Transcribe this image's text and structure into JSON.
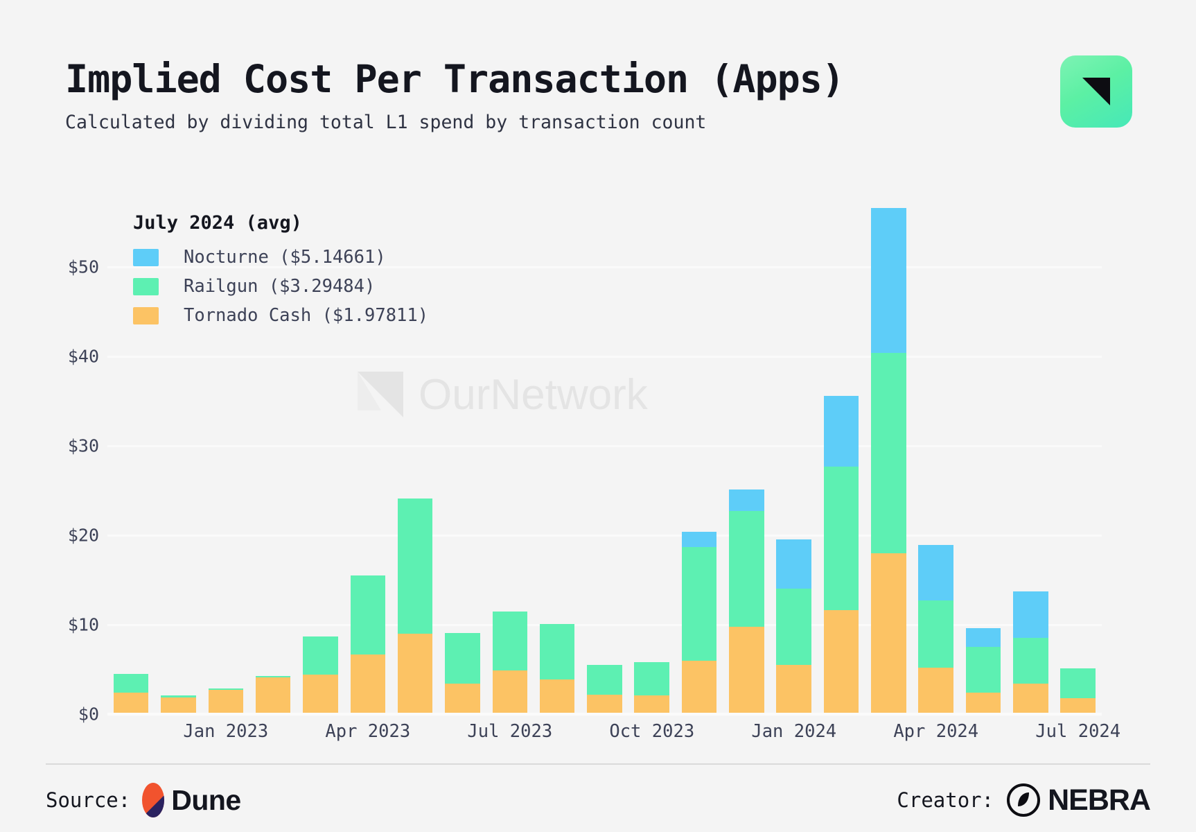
{
  "header": {
    "title": "Implied Cost Per Transaction (Apps)",
    "subtitle": "Calculated by dividing total L1 spend by transaction count",
    "badge_icon": "nebra-corner-triangle-icon"
  },
  "watermark": {
    "text": "OurNetwork",
    "icon": "ournetwork-mark-icon"
  },
  "legend": {
    "title": "July 2024 (avg)",
    "items": [
      {
        "label": "Nocturne ($5.14661)",
        "color": "#5ecdf8",
        "series": "Nocturne",
        "value": "$5.14661"
      },
      {
        "label": "Railgun ($3.29484)",
        "color": "#5df0b2",
        "series": "Railgun",
        "value": "$3.29484"
      },
      {
        "label": "Tornado Cash ($1.97811)",
        "color": "#fcc364",
        "series": "Tornado Cash",
        "value": "$1.97811"
      }
    ]
  },
  "footer": {
    "source_label": "Source:",
    "source_name": "Dune",
    "source_icon": "dune-ellipse-logo-icon",
    "creator_label": "Creator:",
    "creator_name": "NEBRA",
    "creator_icon": "nebra-circle-logo-icon"
  },
  "chart_data": {
    "type": "bar",
    "stacked": true,
    "title": "Implied Cost Per Transaction (Apps)",
    "subtitle": "Calculated by dividing total L1 spend by transaction count",
    "xlabel": "",
    "ylabel": "",
    "ylim": [
      0,
      57
    ],
    "grid": true,
    "legend_position": "top-left",
    "ytick_labels": [
      "$0",
      "$10",
      "$20",
      "$30",
      "$40",
      "$50"
    ],
    "ytick_values": [
      0,
      10,
      20,
      30,
      40,
      50
    ],
    "x": [
      "Nov 2022",
      "Dec 2022",
      "Jan 2023",
      "Feb 2023",
      "Mar 2023",
      "Apr 2023",
      "May 2023",
      "Jun 2023",
      "Jul 2023",
      "Aug 2023",
      "Sep 2023",
      "Oct 2023",
      "Nov 2023",
      "Dec 2023",
      "Jan 2024",
      "Feb 2024",
      "Mar 2024",
      "Apr 2024",
      "May 2024",
      "Jun 2024",
      "Jul 2024"
    ],
    "xtick_labels": [
      "Jan 2023",
      "Apr 2023",
      "Jul 2023",
      "Oct 2023",
      "Jan 2024",
      "Apr 2024",
      "Jul 2024"
    ],
    "xtick_indices": [
      2,
      5,
      8,
      11,
      14,
      17,
      20
    ],
    "series": [
      {
        "name": "Tornado Cash",
        "color": "#fcc364",
        "values": [
          2.4,
          1.9,
          2.7,
          4.1,
          4.4,
          6.7,
          9.0,
          3.4,
          4.9,
          3.9,
          2.2,
          2.1,
          6.0,
          9.8,
          5.5,
          11.6,
          18.0,
          5.2,
          2.4,
          3.4,
          1.8
        ]
      },
      {
        "name": "Railgun",
        "color": "#5df0b2",
        "values": [
          2.1,
          0.2,
          0.2,
          0.2,
          4.3,
          8.8,
          15.1,
          5.7,
          6.6,
          6.2,
          3.3,
          3.7,
          12.7,
          12.9,
          8.5,
          16.1,
          22.4,
          7.5,
          5.1,
          5.1,
          3.3
        ]
      },
      {
        "name": "Nocturne",
        "color": "#5ecdf8",
        "values": [
          0,
          0,
          0,
          0,
          0,
          0,
          0,
          0,
          0,
          0,
          0,
          0,
          1.7,
          2.4,
          5.5,
          7.9,
          16.2,
          6.2,
          2.1,
          5.2,
          0
        ]
      }
    ],
    "totals": [
      4.5,
      2.1,
      2.9,
      4.3,
      8.7,
      15.5,
      24.1,
      9.1,
      11.5,
      10.1,
      5.5,
      5.8,
      20.4,
      25.1,
      19.5,
      35.6,
      56.6,
      18.9,
      9.6,
      13.7,
      5.1
    ]
  }
}
